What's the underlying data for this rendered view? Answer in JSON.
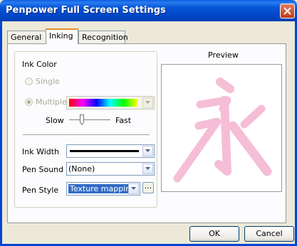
{
  "window": {
    "title": "Penpower Full Screen Settings"
  },
  "tabs": [
    {
      "label": "General"
    },
    {
      "label": "Inking"
    },
    {
      "label": "Recognition"
    }
  ],
  "ink_color": {
    "group_label": "Ink Color",
    "single_label": "Single",
    "multiple_label": "Multiple",
    "selected": "Multiple",
    "speed_slow": "Slow",
    "speed_fast": "Fast"
  },
  "ink_width": {
    "label": "Ink Width"
  },
  "pen_sound": {
    "label": "Pen Sound",
    "value": "(None)"
  },
  "pen_style": {
    "label": "Pen Style",
    "value": "Texture mapping",
    "browse_label": "..."
  },
  "preview": {
    "label": "Preview",
    "character": "永",
    "color": "#f4b8d2"
  },
  "buttons": {
    "ok": "OK",
    "cancel": "Cancel"
  }
}
